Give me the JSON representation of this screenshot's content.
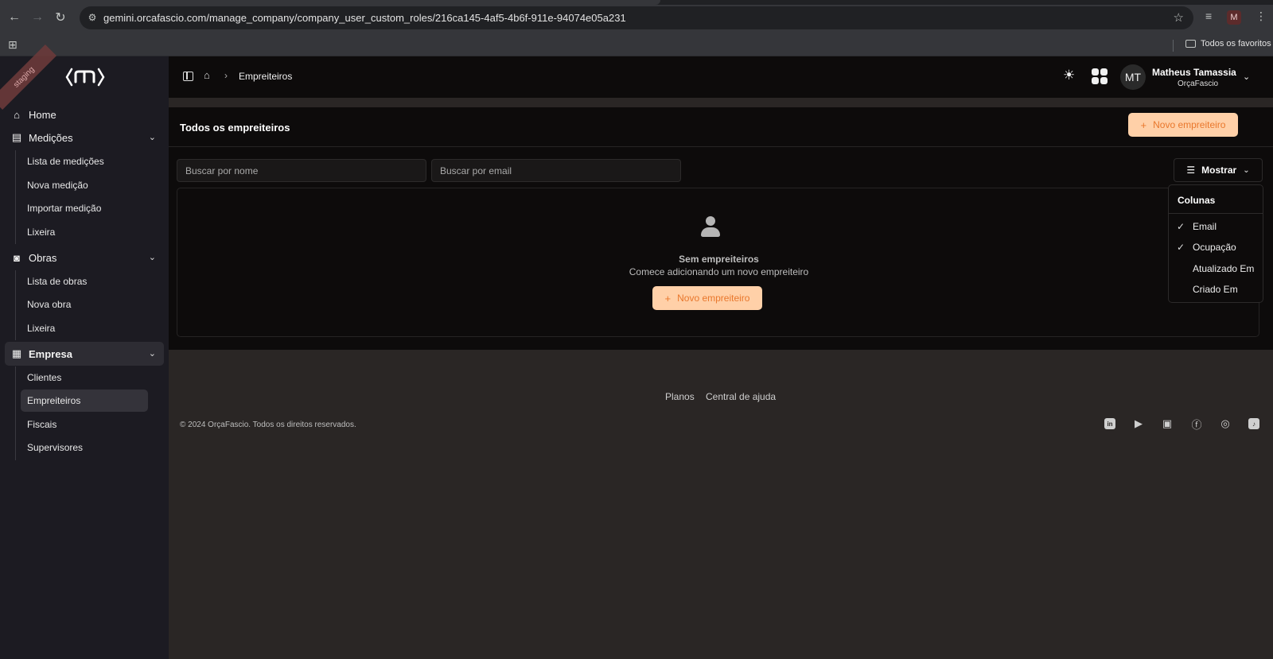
{
  "browser": {
    "url": "gemini.orcafascio.com/manage_company/company_user_custom_roles/216ca145-4af5-4b6f-911e-94074e05a231",
    "profile_initial": "M",
    "bookmarks_folder": "Todos os favoritos"
  },
  "sidebar": {
    "env_badge": "staging",
    "home": "Home",
    "medicoes": {
      "label": "Medições",
      "items": [
        "Lista de medições",
        "Nova medição",
        "Importar medição",
        "Lixeira"
      ]
    },
    "obras": {
      "label": "Obras",
      "items": [
        "Lista de obras",
        "Nova obra",
        "Lixeira"
      ]
    },
    "empresa": {
      "label": "Empresa",
      "items": [
        "Clientes",
        "Empreiteiros",
        "Fiscais",
        "Supervisores"
      ],
      "active_item": "Empreiteiros"
    }
  },
  "topbar": {
    "breadcrumb_current": "Empreiteiros",
    "user": {
      "initials": "MT",
      "name": "Matheus Tamassia",
      "company": "OrçaFascio"
    }
  },
  "main": {
    "title": "Todos os empreiteiros",
    "new_button": "Novo empreiteiro",
    "search_name_placeholder": "Buscar por nome",
    "search_email_placeholder": "Buscar por email",
    "show_button": "Mostrar",
    "empty_title": "Sem empreiteiros",
    "empty_subtitle": "Comece adicionando um novo empreiteiro",
    "empty_button": "Novo empreiteiro"
  },
  "columns_dropdown": {
    "title": "Colunas",
    "items": [
      {
        "label": "Email",
        "checked": true
      },
      {
        "label": "Ocupação",
        "checked": true
      },
      {
        "label": "Atualizado Em",
        "checked": false
      },
      {
        "label": "Criado Em",
        "checked": false
      }
    ]
  },
  "footer": {
    "links": [
      "Planos",
      "Central de ajuda"
    ],
    "copyright": "© 2024 OrçaFascio. Todos os direitos reservados.",
    "social_icons": [
      "linkedin-icon",
      "play-store-icon",
      "youtube-icon",
      "facebook-icon",
      "instagram-icon",
      "tiktok-icon"
    ]
  },
  "colors": {
    "accent_bg": "#ffd0a8",
    "accent_text": "#e9772c",
    "sidebar_bg": "#1c1b22",
    "content_bg": "#0d0b0b"
  }
}
